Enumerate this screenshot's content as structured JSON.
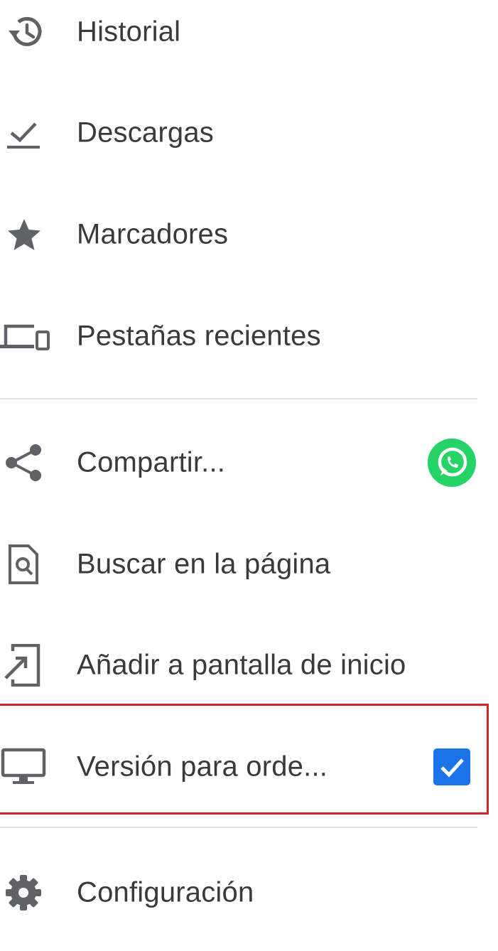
{
  "menu": {
    "items": [
      {
        "id": "history",
        "label": "Historial",
        "icon": "history-icon"
      },
      {
        "id": "downloads",
        "label": "Descargas",
        "icon": "download-done-icon"
      },
      {
        "id": "bookmarks",
        "label": "Marcadores",
        "icon": "star-icon"
      },
      {
        "id": "recent-tabs",
        "label": "Pestañas recientes",
        "icon": "devices-icon"
      },
      {
        "id": "share",
        "label": "Compartir...",
        "icon": "share-icon",
        "trailing_icon": "whatsapp-icon"
      },
      {
        "id": "find",
        "label": "Buscar en la página",
        "icon": "find-in-page-icon"
      },
      {
        "id": "add-home",
        "label": "Añadir a pantalla de inicio",
        "icon": "add-to-home-screen-icon"
      },
      {
        "id": "desktop-site",
        "label": "Versión para orde...",
        "icon": "desktop-icon",
        "checked": true
      },
      {
        "id": "settings",
        "label": "Configuración",
        "icon": "gear-icon"
      }
    ]
  },
  "colors": {
    "text": "#3a3a3a",
    "icon": "#5f6368",
    "divider": "#e3e3e3",
    "checkbox": "#1a73e8",
    "whatsapp": "#25d366",
    "highlight": "#d0262b"
  }
}
